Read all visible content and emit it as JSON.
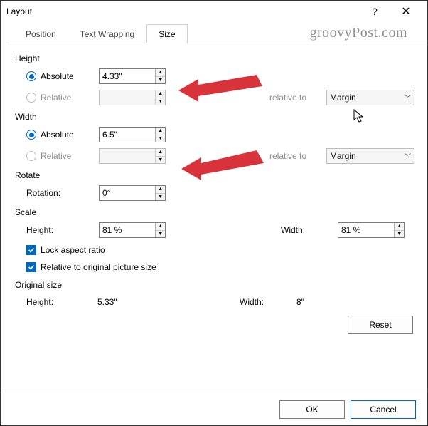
{
  "dialog": {
    "title": "Layout"
  },
  "watermark": "groovyPost.com",
  "tabs": {
    "position": "Position",
    "textwrap": "Text Wrapping",
    "size": "Size"
  },
  "height": {
    "section": "Height",
    "absolute_label": "Absolute",
    "absolute_value": "4.33\"",
    "relative_label": "Relative",
    "relative_value": "",
    "relative_to_label": "relative to",
    "relative_to_value": "Margin"
  },
  "width": {
    "section": "Width",
    "absolute_label": "Absolute",
    "absolute_value": "6.5\"",
    "relative_label": "Relative",
    "relative_value": "",
    "relative_to_label": "relative to",
    "relative_to_value": "Margin"
  },
  "rotate": {
    "section": "Rotate",
    "rotation_label": "Rotation:",
    "rotation_value": "0°"
  },
  "scale": {
    "section": "Scale",
    "height_label": "Height:",
    "height_value": "81 %",
    "width_label": "Width:",
    "width_value": "81 %",
    "lock_label": "Lock aspect ratio",
    "relorig_label": "Relative to original picture size"
  },
  "original": {
    "section": "Original size",
    "height_label": "Height:",
    "height_value": "5.33\"",
    "width_label": "Width:",
    "width_value": "8\""
  },
  "buttons": {
    "reset": "Reset",
    "ok": "OK",
    "cancel": "Cancel"
  }
}
